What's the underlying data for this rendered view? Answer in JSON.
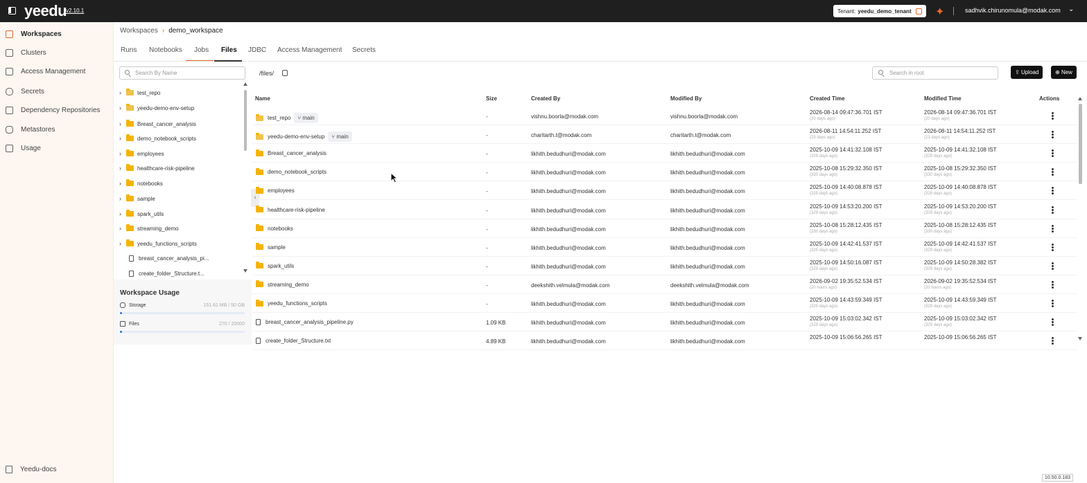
{
  "topbar": {
    "logo": "yeedu",
    "version": "v2.10.1",
    "tenant_label": "Tenant:",
    "tenant_name": "yeedu_demo_tenant",
    "user": "sadhvik.chirunomula@modak.com"
  },
  "leftnav": {
    "items": [
      {
        "label": "Workspaces",
        "icon": "workspace-icon"
      },
      {
        "label": "Clusters",
        "icon": "cluster-icon"
      },
      {
        "label": "Access Management",
        "icon": "access-icon"
      },
      {
        "label": "Secrets",
        "icon": "key-icon"
      },
      {
        "label": "Dependency Repositories",
        "icon": "repository-icon"
      },
      {
        "label": "Metastores",
        "icon": "database-icon"
      },
      {
        "label": "Usage",
        "icon": "usage-icon"
      }
    ],
    "docs": "Yeedu-docs"
  },
  "breadcrumb": {
    "root": "Workspaces",
    "current": "demo_workspace"
  },
  "tabs": [
    "Runs",
    "Notebooks",
    "Jobs",
    "Files",
    "JDBC",
    "Access Management",
    "Secrets"
  ],
  "tree": {
    "search_placeholder": "Search By Name",
    "items": [
      {
        "label": "test_repo",
        "type": "repo"
      },
      {
        "label": "yeedu-demo-env-setup",
        "type": "repo"
      },
      {
        "label": "Breast_cancer_analysis",
        "type": "folder"
      },
      {
        "label": "demo_notebook_scripts",
        "type": "folder"
      },
      {
        "label": "employees",
        "type": "folder"
      },
      {
        "label": "healthcare-risk-pipeline",
        "type": "folder"
      },
      {
        "label": "notebooks",
        "type": "folder"
      },
      {
        "label": "sample",
        "type": "folder"
      },
      {
        "label": "spark_utils",
        "type": "folder"
      },
      {
        "label": "streaming_demo",
        "type": "folder"
      },
      {
        "label": "yeedu_functions_scripts",
        "type": "folder"
      },
      {
        "label": "breast_cancer_analysis_pi...",
        "type": "file"
      },
      {
        "label": "create_folder_Structure.t...",
        "type": "file"
      }
    ]
  },
  "usage": {
    "title": "Workspace Usage",
    "storage_label": "Storage",
    "storage_value": "151.61 MB / 50 GB",
    "storage_fraction": 0.003,
    "files_label": "Files",
    "files_value": "270 / 20000",
    "files_fraction": 0.0135
  },
  "files": {
    "path": "/files/",
    "search_placeholder": "Search in root",
    "upload_label": "Upload",
    "new_label": "New",
    "columns": [
      "Name",
      "Size",
      "Created By",
      "Modified By",
      "Created Time",
      "Modified Time",
      "Actions"
    ],
    "rows": [
      {
        "name": "test_repo",
        "type": "repo",
        "branch": "main",
        "size": "-",
        "created_by": "vishnu.boorla@modak.com",
        "modified_by": "vishnu.boorla@modak.com",
        "created": "2026-08-14 09:47:36.701 IST",
        "created_ago": "(20 days ago)",
        "modified": "2026-08-14 09:47:36.701 IST",
        "modified_ago": "(20 days ago)"
      },
      {
        "name": "yeedu-demo-env-setup",
        "type": "repo",
        "branch": "main",
        "size": "-",
        "created_by": "charitarth.t@modak.com",
        "modified_by": "charitarth.t@modak.com",
        "created": "2026-08-11 14:54:11.252 IST",
        "created_ago": "(23 days ago)",
        "modified": "2026-08-11 14:54:11.252 IST",
        "modified_ago": "(23 days ago)"
      },
      {
        "name": "Breast_cancer_analysis",
        "type": "folder",
        "branch": "",
        "size": "-",
        "created_by": "likhith.bedudhuri@modak.com",
        "modified_by": "likhith.bedudhuri@modak.com",
        "created": "2025-10-09 14:41:32.108 IST",
        "created_ago": "(329 days ago)",
        "modified": "2025-10-09 14:41:32.108 IST",
        "modified_ago": "(329 days ago)"
      },
      {
        "name": "demo_notebook_scripts",
        "type": "folder",
        "branch": "",
        "size": "-",
        "created_by": "likhith.bedudhuri@modak.com",
        "modified_by": "likhith.bedudhuri@modak.com",
        "created": "2025-10-08 15:29:32.350 IST",
        "created_ago": "(330 days ago)",
        "modified": "2025-10-08 15:29:32.350 IST",
        "modified_ago": "(330 days ago)"
      },
      {
        "name": "employees",
        "type": "folder",
        "branch": "",
        "size": "-",
        "created_by": "likhith.bedudhuri@modak.com",
        "modified_by": "likhith.bedudhuri@modak.com",
        "created": "2025-10-09 14:40:08.878 IST",
        "created_ago": "(329 days ago)",
        "modified": "2025-10-09 14:40:08.878 IST",
        "modified_ago": "(329 days ago)"
      },
      {
        "name": "healthcare-risk-pipeline",
        "type": "folder",
        "branch": "",
        "size": "-",
        "created_by": "likhith.bedudhuri@modak.com",
        "modified_by": "likhith.bedudhuri@modak.com",
        "created": "2025-10-09 14:53:20.200 IST",
        "created_ago": "(329 days ago)",
        "modified": "2025-10-09 14:53:20.200 IST",
        "modified_ago": "(329 days ago)"
      },
      {
        "name": "notebooks",
        "type": "folder",
        "branch": "",
        "size": "-",
        "created_by": "likhith.bedudhuri@modak.com",
        "modified_by": "likhith.bedudhuri@modak.com",
        "created": "2025-10-08 15:28:12.435 IST",
        "created_ago": "(330 days ago)",
        "modified": "2025-10-08 15:28:12.435 IST",
        "modified_ago": "(330 days ago)"
      },
      {
        "name": "sample",
        "type": "folder",
        "branch": "",
        "size": "-",
        "created_by": "likhith.bedudhuri@modak.com",
        "modified_by": "likhith.bedudhuri@modak.com",
        "created": "2025-10-09 14:42:41.537 IST",
        "created_ago": "(329 days ago)",
        "modified": "2025-10-09 14:42:41.537 IST",
        "modified_ago": "(329 days ago)"
      },
      {
        "name": "spark_utils",
        "type": "folder",
        "branch": "",
        "size": "-",
        "created_by": "likhith.bedudhuri@modak.com",
        "modified_by": "likhith.bedudhuri@modak.com",
        "created": "2025-10-09 14:50:16.087 IST",
        "created_ago": "(329 days ago)",
        "modified": "2025-10-09 14:50:28.382 IST",
        "modified_ago": "(329 days ago)"
      },
      {
        "name": "streaming_demo",
        "type": "folder",
        "branch": "",
        "size": "-",
        "created_by": "deekshith.velmula@modak.com",
        "modified_by": "deekshith.velmula@modak.com",
        "created": "2026-09-02 19:35:52.534 IST",
        "created_ago": "(20 hours ago)",
        "modified": "2026-09-02 19:35:52.534 IST",
        "modified_ago": "(20 hours ago)"
      },
      {
        "name": "yeedu_functions_scripts",
        "type": "folder",
        "branch": "",
        "size": "-",
        "created_by": "likhith.bedudhuri@modak.com",
        "modified_by": "likhith.bedudhuri@modak.com",
        "created": "2025-10-09 14:43:59.349 IST",
        "created_ago": "(329 days ago)",
        "modified": "2025-10-09 14:43:59.349 IST",
        "modified_ago": "(329 days ago)"
      },
      {
        "name": "breast_cancer_analysis_pipeline.py",
        "type": "file",
        "branch": "",
        "size": "1.09 KB",
        "created_by": "likhith.bedudhuri@modak.com",
        "modified_by": "likhith.bedudhuri@modak.com",
        "created": "2025-10-09 15:03:02.342 IST",
        "created_ago": "(329 days ago)",
        "modified": "2025-10-09 15:03:02.342 IST",
        "modified_ago": "(329 days ago)"
      },
      {
        "name": "create_folder_Structure.txt",
        "type": "file",
        "branch": "",
        "size": "4.89 KB",
        "created_by": "likhith.bedudhuri@modak.com",
        "modified_by": "likhith.bedudhuri@modak.com",
        "created": "2025-10-09 15:06:56.265 IST",
        "created_ago": "",
        "modified": "2025-10-09 15:06:56.265 IST",
        "modified_ago": ""
      }
    ]
  },
  "footer": {
    "ip": "10.50.0.183"
  },
  "colors": {
    "accent": "#e8672a",
    "topbar": "#1f1f1f",
    "folder": "#f5b301"
  }
}
